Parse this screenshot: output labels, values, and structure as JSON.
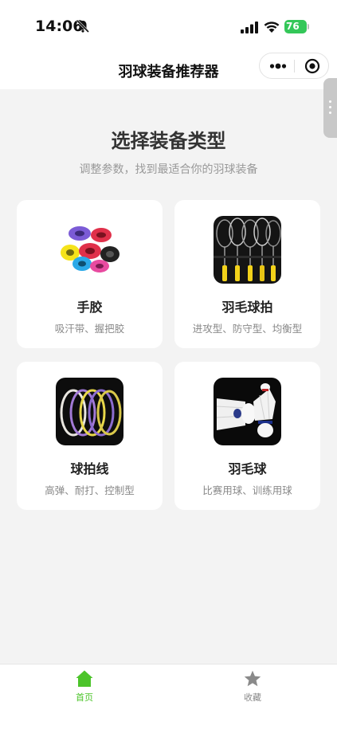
{
  "status_bar": {
    "time": "14:06",
    "battery": "76",
    "icons": [
      "bell-slash-icon",
      "signal-icon",
      "wifi-icon",
      "battery-icon"
    ]
  },
  "nav": {
    "title": "羽球装备推荐器",
    "capsule_icons": [
      "more-icon",
      "target-icon"
    ]
  },
  "main": {
    "heading": "选择装备类型",
    "subheading": "调整参数，找到最适合你的羽球装备"
  },
  "categories": [
    {
      "title": "手胶",
      "desc": "吸汗带、握把胶",
      "image": "grip-tape-image"
    },
    {
      "title": "羽毛球拍",
      "desc": "进攻型、防守型、均衡型",
      "image": "rackets-image"
    },
    {
      "title": "球拍线",
      "desc": "高弹、耐打、控制型",
      "image": "strings-image"
    },
    {
      "title": "羽毛球",
      "desc": "比赛用球、训练用球",
      "image": "shuttlecock-image"
    }
  ],
  "tabbar": {
    "items": [
      {
        "label": "首页",
        "icon": "home-icon",
        "active": true
      },
      {
        "label": "收藏",
        "icon": "star-icon",
        "active": false
      }
    ]
  },
  "colors": {
    "accent": "#4cc42a",
    "inactive": "#888888",
    "background": "#f3f3f3"
  }
}
